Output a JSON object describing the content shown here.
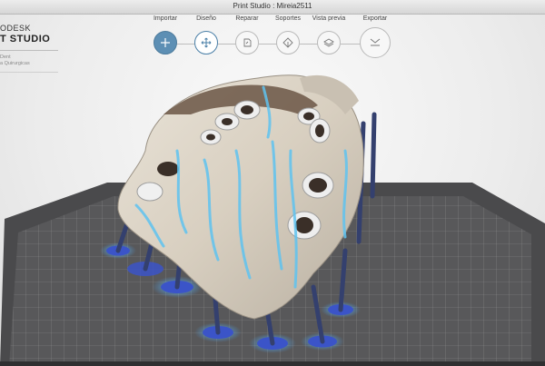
{
  "window": {
    "title": "Print Studio : Mireia2511"
  },
  "brand": {
    "line1": "ODESK",
    "line2": "T STUDIO",
    "project_line1": "Dent",
    "project_line2": "a Quirurgicas"
  },
  "workflow": {
    "steps": [
      {
        "label": "Importar",
        "icon": "plus-icon",
        "state": "active"
      },
      {
        "label": "Diseño",
        "icon": "move-icon",
        "state": "current"
      },
      {
        "label": "Reparar",
        "icon": "repair-icon",
        "state": "default"
      },
      {
        "label": "Soportes",
        "icon": "supports-icon",
        "state": "default"
      },
      {
        "label": "Vista previa",
        "icon": "layers-icon",
        "state": "default"
      },
      {
        "label": "Exportar",
        "icon": "export-icon",
        "state": "default"
      }
    ]
  },
  "colors": {
    "accent": "#5d8fb4",
    "support_blue": "#3b54c8",
    "highlight_cyan": "#5fc3f0",
    "platform_dark": "#3c3c3e",
    "model_bone": "#d8d0c3"
  }
}
